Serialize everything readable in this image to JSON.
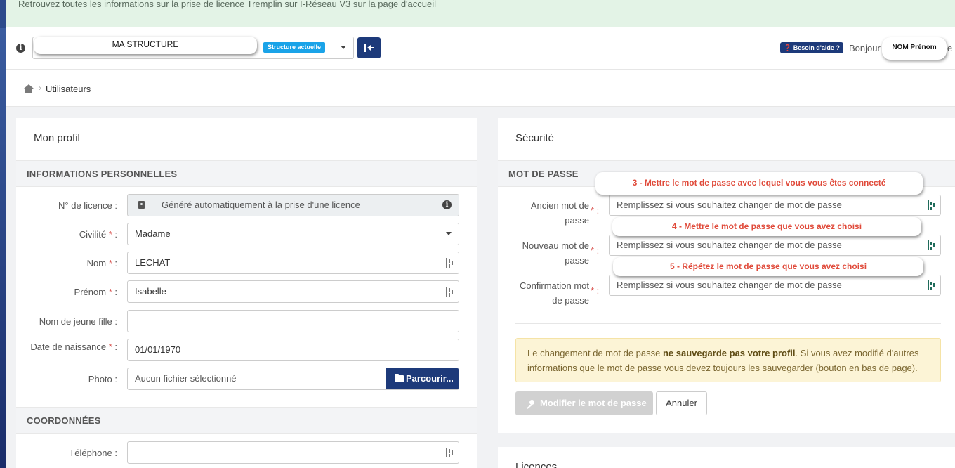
{
  "banner": {
    "text": "Retrouvez toutes les informations sur la prise de licence Tremplin sur I-Réseau V3 sur la",
    "link": "page d'accueil"
  },
  "topbar": {
    "structure_name": "MA STRUCTURE",
    "structure_badge": "Structure actuelle",
    "help_label": "Besoin d'aide ?",
    "greeting": "Bonjour",
    "user_name": "NOM Prénom",
    "greeting_tail": "e"
  },
  "breadcrumb": {
    "current": "Utilisateurs"
  },
  "profile": {
    "title": "Mon profil",
    "section_personal": "INFORMATIONS PERSONNELLES",
    "section_contact": "COORDONNÉES",
    "fields": {
      "licence": {
        "label": "N° de licence :",
        "value": "Généré automatiquement à la prise d'une licence"
      },
      "civilite": {
        "label": "Civilité",
        "value": "Madame"
      },
      "nom": {
        "label": "Nom",
        "value": "LECHAT"
      },
      "prenom": {
        "label": "Prénom",
        "value": "Isabelle"
      },
      "nom_jeune_fille": {
        "label": "Nom de jeune fille :",
        "value": ""
      },
      "date_naissance": {
        "label": "Date de naissance",
        "value": "01/01/1970"
      },
      "photo": {
        "label": "Photo :",
        "value": "Aucun fichier sélectionné",
        "button": "Parcourir..."
      },
      "telephone": {
        "label": "Téléphone :",
        "value": ""
      }
    },
    "required_mark": "*",
    "colon": ":"
  },
  "security": {
    "title": "Sécurité",
    "section_password": "MOT DE PASSE",
    "old_password": {
      "label_line1": "Ancien mot de",
      "label_line2": "passe",
      "placeholder": "Remplissez si vous souhaitez changer de mot de passe"
    },
    "new_password": {
      "label_line1": "Nouveau mot de",
      "label_line2": "passe",
      "placeholder": "Remplissez si vous souhaitez changer de mot de passe"
    },
    "confirm_password": {
      "label_line1": "Confirmation mot",
      "label_line2": "de passe",
      "placeholder": "Remplissez si vous souhaitez changer de mot de passe"
    },
    "warning_part1": "Le changement de mot de passe ",
    "warning_bold": "ne sauvegarde pas votre profil",
    "warning_part2": ". Si vous avez modifié d'autres informations que le mot de passe vous devez toujours les sauvegarder (bouton en bas de page).",
    "btn_modify": "Modifier le mot de passe",
    "btn_cancel": "Annuler"
  },
  "callouts": {
    "step3": "3  - Mettre le mot de passe avec lequel vous vous êtes connecté",
    "step4": "4 - Mettre le mot de passe que vous avez choisi",
    "step5": "5 - Répétez le mot de passe que vous avez choisi"
  },
  "licences": {
    "title": "Licences"
  },
  "colors": {
    "primary": "#1d3a7a",
    "badge": "#1aa3e8",
    "annotation": "#e04a3a",
    "warning_bg": "#fcf4d6"
  }
}
